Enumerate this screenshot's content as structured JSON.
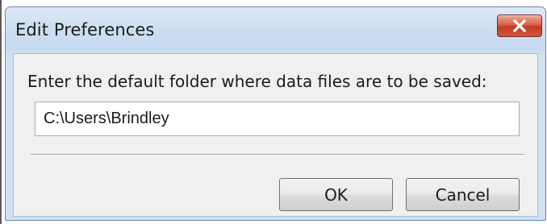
{
  "window": {
    "title": "Edit Preferences"
  },
  "form": {
    "prompt": "Enter the default folder where data files are to be saved:",
    "path_value": "C:\\Users\\Brindley"
  },
  "buttons": {
    "ok_label": "OK",
    "cancel_label": "Cancel"
  },
  "colors": {
    "titlebar": "#cfe0f3",
    "close_button": "#c9442b",
    "client_background": "#f0f0f0"
  },
  "icons": {
    "close": "close-icon"
  }
}
